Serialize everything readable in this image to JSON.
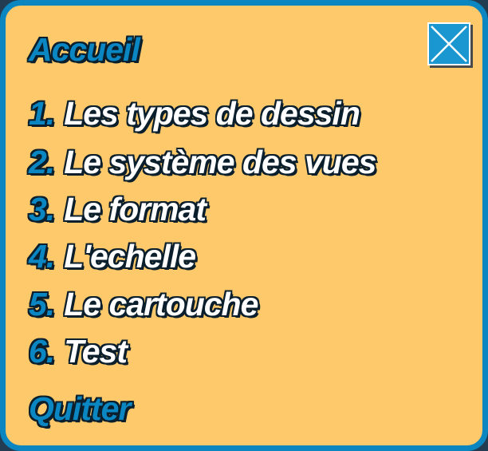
{
  "menu": {
    "home_label": "Accueil",
    "close_icon": "close-icon",
    "items": [
      {
        "number": "1.",
        "label": "Les types de dessin"
      },
      {
        "number": "2.",
        "label": "Le système des vues"
      },
      {
        "number": "3.",
        "label": "Le format"
      },
      {
        "number": "4.",
        "label": "L'echelle"
      },
      {
        "number": "5.",
        "label": "Le cartouche"
      },
      {
        "number": "6.",
        "label": "Test"
      }
    ],
    "quit_label": "Quitter"
  },
  "colors": {
    "panel_background": "#fdc96a",
    "panel_border": "#0b86c0",
    "accent_blue": "#0a86c2",
    "text_white": "#ffffff"
  }
}
